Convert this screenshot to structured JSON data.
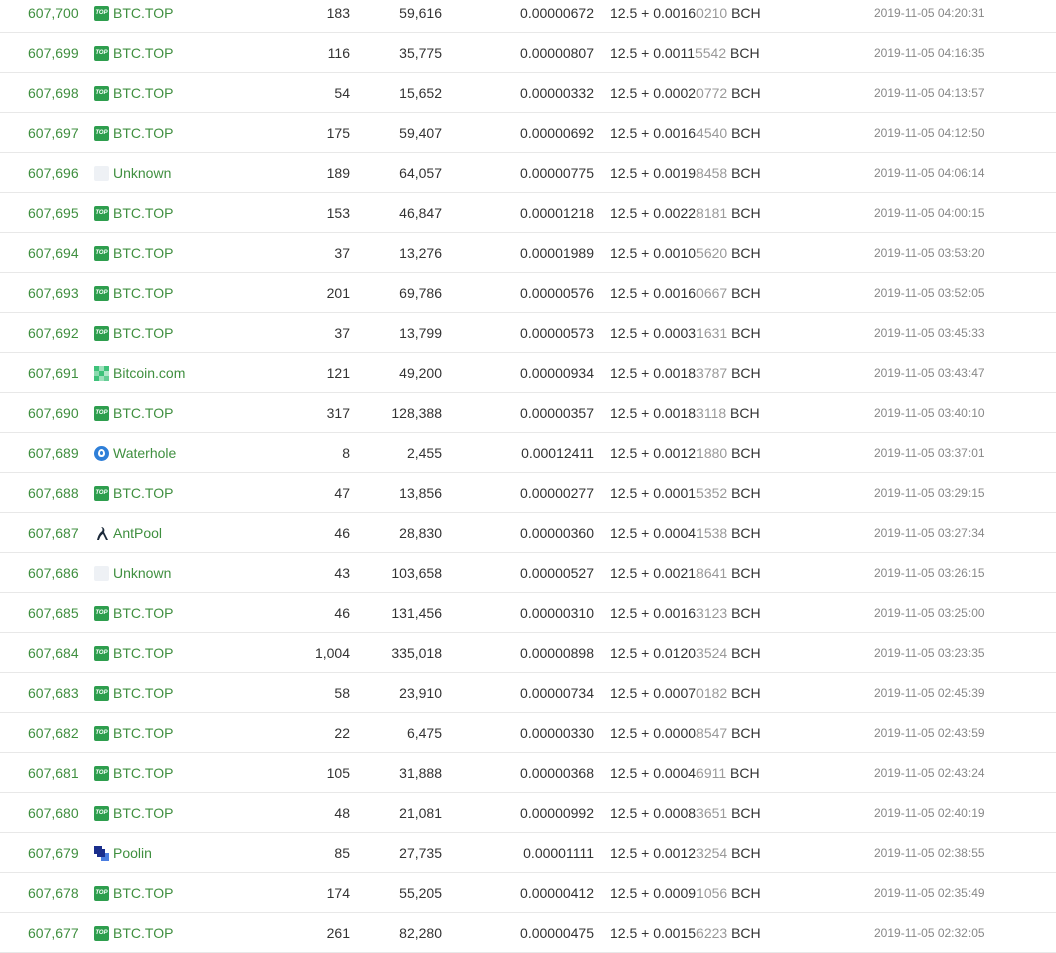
{
  "rows": [
    {
      "height": "607,700",
      "miner": "BTC.TOP",
      "icon": "btctop",
      "txs": "183",
      "size": "59,616",
      "fee": "0.00000672",
      "reward_main": "12.5 + 0.0016",
      "reward_dim": "0210",
      "unit": " BCH",
      "time": "2019-11-05 04:20:31"
    },
    {
      "height": "607,699",
      "miner": "BTC.TOP",
      "icon": "btctop",
      "txs": "116",
      "size": "35,775",
      "fee": "0.00000807",
      "reward_main": "12.5 + 0.0011",
      "reward_dim": "5542",
      "unit": " BCH",
      "time": "2019-11-05 04:16:35"
    },
    {
      "height": "607,698",
      "miner": "BTC.TOP",
      "icon": "btctop",
      "txs": "54",
      "size": "15,652",
      "fee": "0.00000332",
      "reward_main": "12.5 + 0.0002",
      "reward_dim": "0772",
      "unit": " BCH",
      "time": "2019-11-05 04:13:57"
    },
    {
      "height": "607,697",
      "miner": "BTC.TOP",
      "icon": "btctop",
      "txs": "175",
      "size": "59,407",
      "fee": "0.00000692",
      "reward_main": "12.5 + 0.0016",
      "reward_dim": "4540",
      "unit": " BCH",
      "time": "2019-11-05 04:12:50"
    },
    {
      "height": "607,696",
      "miner": "Unknown",
      "icon": "unknown",
      "txs": "189",
      "size": "64,057",
      "fee": "0.00000775",
      "reward_main": "12.5 + 0.0019",
      "reward_dim": "8458",
      "unit": " BCH",
      "time": "2019-11-05 04:06:14"
    },
    {
      "height": "607,695",
      "miner": "BTC.TOP",
      "icon": "btctop",
      "txs": "153",
      "size": "46,847",
      "fee": "0.00001218",
      "reward_main": "12.5 + 0.0022",
      "reward_dim": "8181",
      "unit": " BCH",
      "time": "2019-11-05 04:00:15"
    },
    {
      "height": "607,694",
      "miner": "BTC.TOP",
      "icon": "btctop",
      "txs": "37",
      "size": "13,276",
      "fee": "0.00001989",
      "reward_main": "12.5 + 0.0010",
      "reward_dim": "5620",
      "unit": " BCH",
      "time": "2019-11-05 03:53:20"
    },
    {
      "height": "607,693",
      "miner": "BTC.TOP",
      "icon": "btctop",
      "txs": "201",
      "size": "69,786",
      "fee": "0.00000576",
      "reward_main": "12.5 + 0.0016",
      "reward_dim": "0667",
      "unit": " BCH",
      "time": "2019-11-05 03:52:05"
    },
    {
      "height": "607,692",
      "miner": "BTC.TOP",
      "icon": "btctop",
      "txs": "37",
      "size": "13,799",
      "fee": "0.00000573",
      "reward_main": "12.5 + 0.0003",
      "reward_dim": "1631",
      "unit": " BCH",
      "time": "2019-11-05 03:45:33"
    },
    {
      "height": "607,691",
      "miner": "Bitcoin.com",
      "icon": "bitcoincom",
      "txs": "121",
      "size": "49,200",
      "fee": "0.00000934",
      "reward_main": "12.5 + 0.0018",
      "reward_dim": "3787",
      "unit": " BCH",
      "time": "2019-11-05 03:43:47"
    },
    {
      "height": "607,690",
      "miner": "BTC.TOP",
      "icon": "btctop",
      "txs": "317",
      "size": "128,388",
      "fee": "0.00000357",
      "reward_main": "12.5 + 0.0018",
      "reward_dim": "3118",
      "unit": " BCH",
      "time": "2019-11-05 03:40:10"
    },
    {
      "height": "607,689",
      "miner": "Waterhole",
      "icon": "waterhole",
      "txs": "8",
      "size": "2,455",
      "fee": "0.00012411",
      "reward_main": "12.5 + 0.0012",
      "reward_dim": "1880",
      "unit": " BCH",
      "time": "2019-11-05 03:37:01"
    },
    {
      "height": "607,688",
      "miner": "BTC.TOP",
      "icon": "btctop",
      "txs": "47",
      "size": "13,856",
      "fee": "0.00000277",
      "reward_main": "12.5 + 0.0001",
      "reward_dim": "5352",
      "unit": " BCH",
      "time": "2019-11-05 03:29:15"
    },
    {
      "height": "607,687",
      "miner": "AntPool",
      "icon": "antpool",
      "txs": "46",
      "size": "28,830",
      "fee": "0.00000360",
      "reward_main": "12.5 + 0.0004",
      "reward_dim": "1538",
      "unit": " BCH",
      "time": "2019-11-05 03:27:34"
    },
    {
      "height": "607,686",
      "miner": "Unknown",
      "icon": "unknown",
      "txs": "43",
      "size": "103,658",
      "fee": "0.00000527",
      "reward_main": "12.5 + 0.0021",
      "reward_dim": "8641",
      "unit": " BCH",
      "time": "2019-11-05 03:26:15"
    },
    {
      "height": "607,685",
      "miner": "BTC.TOP",
      "icon": "btctop",
      "txs": "46",
      "size": "131,456",
      "fee": "0.00000310",
      "reward_main": "12.5 + 0.0016",
      "reward_dim": "3123",
      "unit": " BCH",
      "time": "2019-11-05 03:25:00"
    },
    {
      "height": "607,684",
      "miner": "BTC.TOP",
      "icon": "btctop",
      "txs": "1,004",
      "size": "335,018",
      "fee": "0.00000898",
      "reward_main": "12.5 + 0.0120",
      "reward_dim": "3524",
      "unit": " BCH",
      "time": "2019-11-05 03:23:35"
    },
    {
      "height": "607,683",
      "miner": "BTC.TOP",
      "icon": "btctop",
      "txs": "58",
      "size": "23,910",
      "fee": "0.00000734",
      "reward_main": "12.5 + 0.0007",
      "reward_dim": "0182",
      "unit": " BCH",
      "time": "2019-11-05 02:45:39"
    },
    {
      "height": "607,682",
      "miner": "BTC.TOP",
      "icon": "btctop",
      "txs": "22",
      "size": "6,475",
      "fee": "0.00000330",
      "reward_main": "12.5 + 0.0000",
      "reward_dim": "8547",
      "unit": " BCH",
      "time": "2019-11-05 02:43:59"
    },
    {
      "height": "607,681",
      "miner": "BTC.TOP",
      "icon": "btctop",
      "txs": "105",
      "size": "31,888",
      "fee": "0.00000368",
      "reward_main": "12.5 + 0.0004",
      "reward_dim": "6911",
      "unit": " BCH",
      "time": "2019-11-05 02:43:24"
    },
    {
      "height": "607,680",
      "miner": "BTC.TOP",
      "icon": "btctop",
      "txs": "48",
      "size": "21,081",
      "fee": "0.00000992",
      "reward_main": "12.5 + 0.0008",
      "reward_dim": "3651",
      "unit": " BCH",
      "time": "2019-11-05 02:40:19"
    },
    {
      "height": "607,679",
      "miner": "Poolin",
      "icon": "poolin",
      "txs": "85",
      "size": "27,735",
      "fee": "0.00001111",
      "reward_main": "12.5 + 0.0012",
      "reward_dim": "3254",
      "unit": " BCH",
      "time": "2019-11-05 02:38:55"
    },
    {
      "height": "607,678",
      "miner": "BTC.TOP",
      "icon": "btctop",
      "txs": "174",
      "size": "55,205",
      "fee": "0.00000412",
      "reward_main": "12.5 + 0.0009",
      "reward_dim": "1056",
      "unit": " BCH",
      "time": "2019-11-05 02:35:49"
    },
    {
      "height": "607,677",
      "miner": "BTC.TOP",
      "icon": "btctop",
      "txs": "261",
      "size": "82,280",
      "fee": "0.00000475",
      "reward_main": "12.5 + 0.0015",
      "reward_dim": "6223",
      "unit": " BCH",
      "time": "2019-11-05 02:32:05"
    }
  ],
  "icon_text": {
    "btctop": "TOP"
  },
  "colors": {
    "link": "#3f8f3f",
    "btctop": "#2e9e4e",
    "waterhole": "#2f7fd8",
    "poolin_dark": "#1a2e8c",
    "poolin_light": "#4a7de0",
    "bitcoincom": "#3ec27a"
  }
}
